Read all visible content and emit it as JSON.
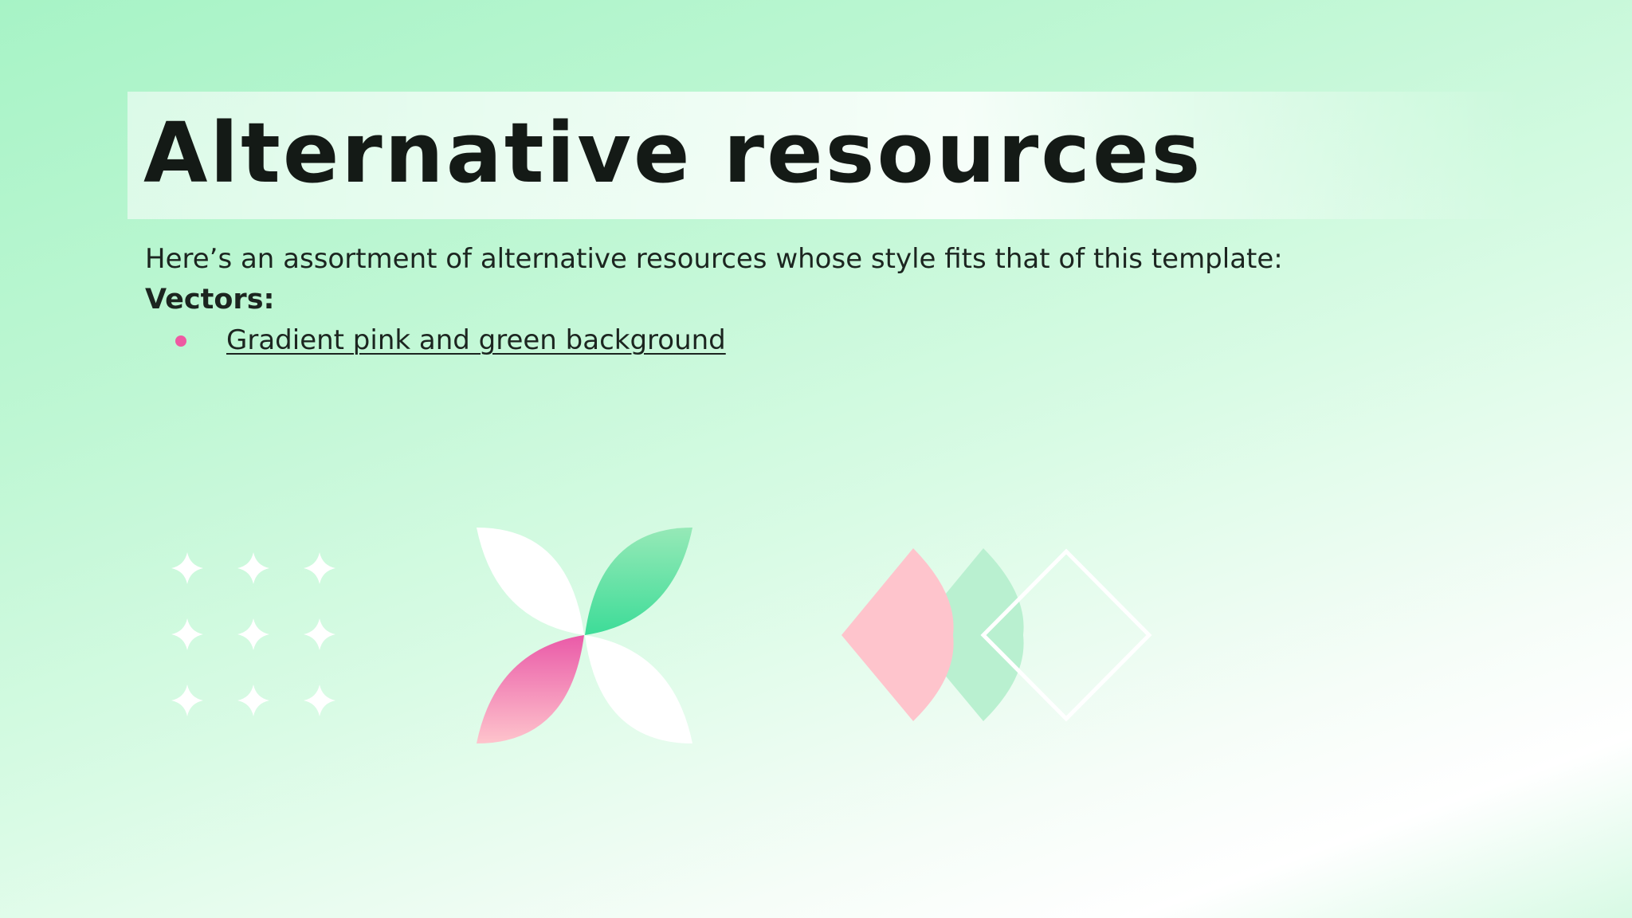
{
  "slide": {
    "title": "Alternative resources",
    "intro": "Here’s an assortment of alternative resources whose style fits that of this template:",
    "vectors_label": "Vectors:",
    "links": [
      {
        "label": "Gradient pink and green background"
      }
    ]
  },
  "colors": {
    "accent_pink": "#ee5aa2",
    "light_pink": "#fec4cc",
    "accent_green": "#3ddc98",
    "light_green": "#b9f0d0",
    "text": "#141a16"
  },
  "icons": [
    "sparkle-icon",
    "petal-flower-icon",
    "diamond-shapes-icon"
  ]
}
